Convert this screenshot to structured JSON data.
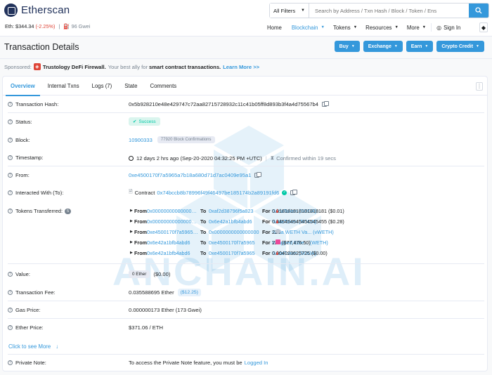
{
  "header": {
    "logo_text": "Etherscan",
    "eth_label": "Eth:",
    "eth_price": "$344.34",
    "eth_change": "(-2.25%)",
    "gas": "96 Gwei",
    "filter_label": "All Filters",
    "search_placeholder": "Search by Address / Txn Hash / Block / Token / Ens",
    "nav": [
      "Home",
      "Blockchain",
      "Tokens",
      "Resources",
      "More",
      "Sign In"
    ]
  },
  "page": {
    "title": "Transaction Details",
    "buttons": [
      "Buy",
      "Exchange",
      "Earn",
      "Crypto Credit"
    ],
    "sponsored_label": "Sponsored:",
    "sponsor_name": "Trustology DeFi Firewall.",
    "sponsor_text": "Your best ally for",
    "sponsor_strong": "smart contract transactions.",
    "sponsor_link": "Learn More >>",
    "watermark": "ANCHAIN.AI"
  },
  "tabs": [
    "Overview",
    "Internal Txns",
    "Logs (7)",
    "State",
    "Comments"
  ],
  "details": {
    "hash_label": "Transaction Hash:",
    "hash": "0x5b928210e48e429747c72aa82715728932c11c41b05ff8d893b3f4a4d75567b4",
    "status_label": "Status:",
    "status": "Success",
    "block_label": "Block:",
    "block": "10900333",
    "confirmations": "77920 Block Confirmations",
    "timestamp_label": "Timestamp:",
    "timestamp": "12 days 2 hrs ago (Sep-20-2020 04:32:25 PM +UTC)",
    "confirmed": "Confirmed within 19 secs",
    "from_label": "From:",
    "from": "0xe4500170f7a5965a7b18a680d71d7ac0409e95a1",
    "interacted_label": "Interacted With (To):",
    "contract_prefix": "Contract",
    "contract": "0x74bccb8b78996f49f46497be185174b2a89191fd6",
    "tokens_label": "Tokens Transferred:",
    "tokens_count": "5",
    "value_label": "Value:",
    "value_ether": "0 Ether",
    "value_usd": "($0.00)",
    "fee_label": "Transaction Fee:",
    "fee": "0.035588695 Ether",
    "fee_usd": "($12.25)",
    "gas_price_label": "Gas Price:",
    "gas_price": "0.000000173 Ether (173 Gwei)",
    "ether_price_label": "Ether Price:",
    "ether_price": "$371.06 / ETH",
    "click_more": "Click to see More",
    "note_label": "Private Note:",
    "note_text": "To access the Private Note feature, you must be",
    "note_link": "Logged In"
  },
  "transfers": [
    {
      "from_kw": "From",
      "from": "0x0000000000000000000000000000000000000000",
      "to_kw": "To",
      "to": "0xaf2d38796f5a823",
      "for_kw": "For",
      "amount": "0.018181818181818181 ($0.01)",
      "token": "SodaToken (SODA)",
      "icon": "soda-icon"
    },
    {
      "from_kw": "From",
      "from": "0x0000000000000000000000000000000000000000",
      "to_kw": "To",
      "to": "0x6e42a1bfb4abd6",
      "for_kw": "For",
      "amount": "0.345454545454545455 ($0.28)",
      "token": "SodaToken (SODA)",
      "icon": "soda-icon"
    },
    {
      "from_kw": "From",
      "from": "0xe4500170f7a5965a7b18a680d71d7ac0409e95a1",
      "to_kw": "To",
      "to": "0x0000000000000000",
      "for_kw": "For",
      "amount": "225",
      "token": "Soda WETH Va... (vWETH)",
      "icon": "vweth-icon"
    },
    {
      "from_kw": "From",
      "from": "0x6e42a1bfb4abd6",
      "to_kw": "To",
      "to": "0xe4500170f7a5965",
      "for_kw": "For",
      "amount": "225 ($77,476.50)",
      "token": "Wrapped Ethe... (WETH)",
      "icon": "weth-icon"
    },
    {
      "from_kw": "From",
      "from": "0x6e42a1bfb4abd6",
      "to_kw": "To",
      "to": "0xe4500170f7a5965",
      "for_kw": "For",
      "amount": "0.004023625725 ($0.00)",
      "token": "SodaToken (SODA)",
      "icon": "soda-icon"
    }
  ],
  "colors": {
    "accent": "#3498db",
    "success": "#00c9a7",
    "negative": "#de4437"
  }
}
